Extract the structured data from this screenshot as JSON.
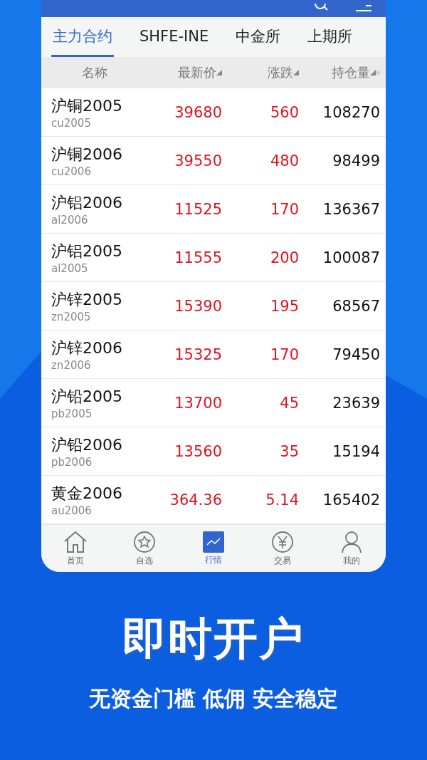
{
  "tabs": [
    {
      "label": "主力合约",
      "selected": true
    },
    {
      "label": "SHFE-INE",
      "selected": false
    },
    {
      "label": "中金所",
      "selected": false
    },
    {
      "label": "上期所",
      "selected": false
    }
  ],
  "table": {
    "columns": [
      "名称",
      "最新价",
      "涨跌",
      "持仓量"
    ],
    "rows": [
      {
        "name": "沪铜2005",
        "code": "cu2005",
        "price": "39680",
        "change": "560",
        "open_interest": "108270"
      },
      {
        "name": "沪铜2006",
        "code": "cu2006",
        "price": "39550",
        "change": "480",
        "open_interest": "98499"
      },
      {
        "name": "沪铝2006",
        "code": "al2006",
        "price": "11525",
        "change": "170",
        "open_interest": "136367"
      },
      {
        "name": "沪铝2005",
        "code": "al2005",
        "price": "11555",
        "change": "200",
        "open_interest": "100087"
      },
      {
        "name": "沪锌2005",
        "code": "zn2005",
        "price": "15390",
        "change": "195",
        "open_interest": "68567"
      },
      {
        "name": "沪锌2006",
        "code": "zn2006",
        "price": "15325",
        "change": "170",
        "open_interest": "79450"
      },
      {
        "name": "沪铅2005",
        "code": "pb2005",
        "price": "13700",
        "change": "45",
        "open_interest": "23639"
      },
      {
        "name": "沪铅2006",
        "code": "pb2006",
        "price": "13560",
        "change": "35",
        "open_interest": "15194"
      },
      {
        "name": "黄金2006",
        "code": "au2006",
        "price": "364.36",
        "change": "5.14",
        "open_interest": "165402"
      }
    ]
  },
  "bottom_nav": [
    {
      "label": "首页",
      "kind": "home",
      "selected": false
    },
    {
      "label": "自选",
      "kind": "star",
      "selected": false
    },
    {
      "label": "行情",
      "kind": "chart",
      "selected": true
    },
    {
      "label": "交易",
      "kind": "yen",
      "selected": false
    },
    {
      "label": "我的",
      "kind": "user",
      "selected": false
    }
  ],
  "headline": "即时开户",
  "tagline": "无资金门槛 低佣 安全稳定"
}
